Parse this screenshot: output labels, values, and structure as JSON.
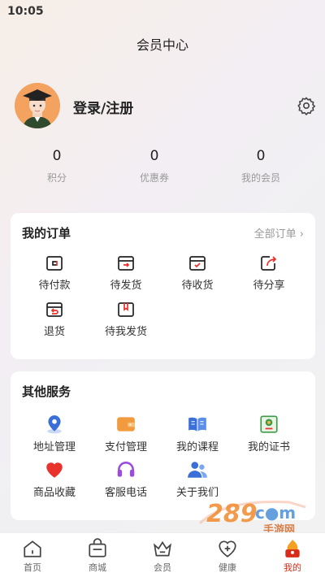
{
  "status": {
    "time": "10:05"
  },
  "header": {
    "title": "会员中心"
  },
  "profile": {
    "login_label": "登录/注册"
  },
  "stats": [
    {
      "value": "0",
      "label": "积分"
    },
    {
      "value": "0",
      "label": "优惠券"
    },
    {
      "value": "0",
      "label": "我的会员"
    }
  ],
  "orders": {
    "title": "我的订单",
    "all_label": "全部订单 ›",
    "items": [
      {
        "label": "待付款",
        "icon": "wallet-icon"
      },
      {
        "label": "待发货",
        "icon": "box-send-icon"
      },
      {
        "label": "待收货",
        "icon": "box-check-icon"
      },
      {
        "label": "待分享",
        "icon": "share-icon"
      },
      {
        "label": "退货",
        "icon": "return-icon"
      },
      {
        "label": "待我发货",
        "icon": "gift-box-icon"
      }
    ]
  },
  "services": {
    "title": "其他服务",
    "items": [
      {
        "label": "地址管理",
        "icon": "location-pin-icon"
      },
      {
        "label": "支付管理",
        "icon": "wallet-icon"
      },
      {
        "label": "我的课程",
        "icon": "book-icon"
      },
      {
        "label": "我的证书",
        "icon": "certificate-icon"
      },
      {
        "label": "商品收藏",
        "icon": "heart-icon"
      },
      {
        "label": "客服电话",
        "icon": "headset-icon"
      },
      {
        "label": "关于我们",
        "icon": "people-icon"
      }
    ]
  },
  "tabbar": {
    "items": [
      {
        "label": "首页",
        "icon": "home-icon"
      },
      {
        "label": "商城",
        "icon": "shop-icon"
      },
      {
        "label": "会员",
        "icon": "crown-icon"
      },
      {
        "label": "健康",
        "icon": "health-icon"
      },
      {
        "label": "我的",
        "icon": "profile-icon",
        "active": true
      }
    ]
  },
  "colors": {
    "accent": "#d82c1a",
    "service_blue": "#3a6fd8",
    "service_orange": "#f19a3e",
    "service_red": "#e8322b",
    "service_purple": "#9a4ddb",
    "service_green": "#3c9a4a"
  }
}
